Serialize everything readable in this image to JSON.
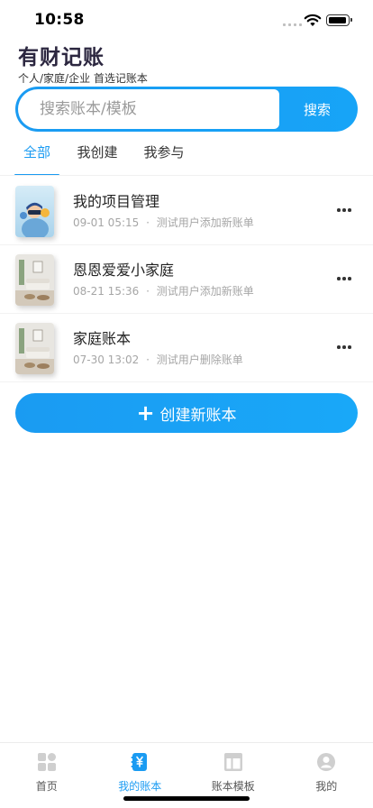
{
  "status_bar": {
    "time": "10:58"
  },
  "header": {
    "title": "有财记账",
    "subtitle": "个人/家庭/企业 首选记账本"
  },
  "search": {
    "placeholder": "搜索账本/模板",
    "value": "",
    "button_label": "搜索"
  },
  "tabs": [
    {
      "label": "全部",
      "active": true
    },
    {
      "label": "我创建",
      "active": false
    },
    {
      "label": "我参与",
      "active": false
    }
  ],
  "books": [
    {
      "name": "我的项目管理",
      "date": "09-01 05:15",
      "sep": "·",
      "activity": "测试用户添加新账单",
      "thumb": "figure-illustration"
    },
    {
      "name": "恩恩爱爱小家庭",
      "date": "08-21 15:36",
      "sep": "·",
      "activity": "测试用户添加新账单",
      "thumb": "living-room-photo"
    },
    {
      "name": "家庭账本",
      "date": "07-30 13:02",
      "sep": "·",
      "activity": "测试用户删除账单",
      "thumb": "living-room-photo"
    }
  ],
  "create_button": {
    "icon": "+",
    "label": "创建新账本"
  },
  "bottom_nav": [
    {
      "label": "首页",
      "icon": "home-grid-icon",
      "active": false
    },
    {
      "label": "我的账本",
      "icon": "ledger-yen-icon",
      "active": true
    },
    {
      "label": "账本模板",
      "icon": "template-layout-icon",
      "active": false
    },
    {
      "label": "我的",
      "icon": "user-avatar-icon",
      "active": false
    }
  ],
  "colors": {
    "accent": "#1a9bf2",
    "title": "#2c2740",
    "meta": "#a6a6a6"
  }
}
